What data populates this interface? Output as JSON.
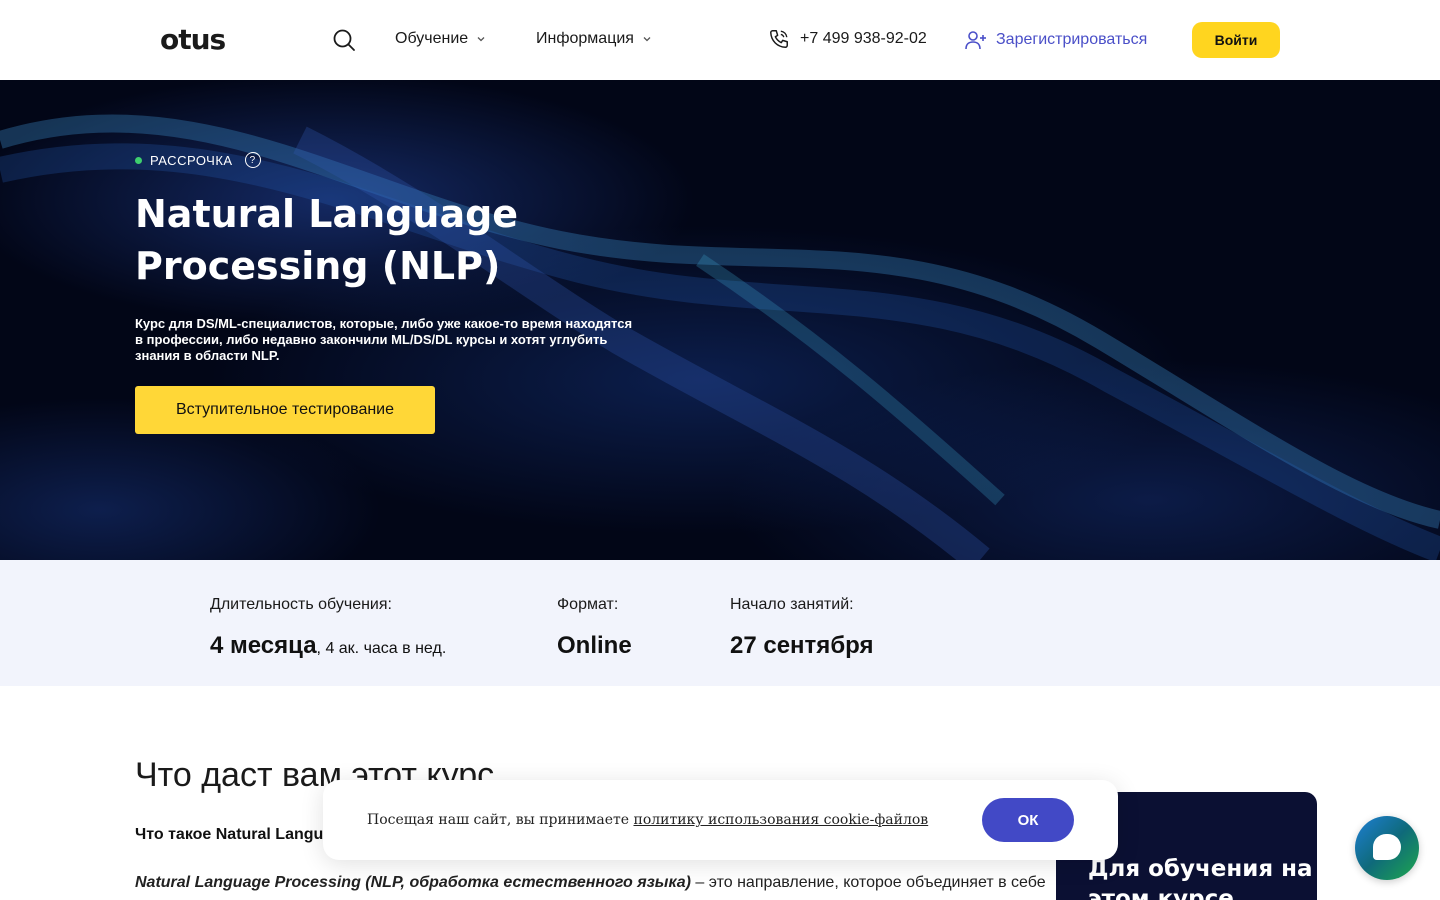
{
  "header": {
    "logo": "otus",
    "nav": [
      {
        "label": "Обучение"
      },
      {
        "label": "Информация"
      }
    ],
    "phone": "+7 499 938-92-02",
    "register_label": "Зарегистрироваться",
    "login_label": "Войти"
  },
  "hero": {
    "badge": "РАССРОЧКА",
    "badge_help": "?",
    "title": "Natural Language Processing (NLP)",
    "description": "Курс для DS/ML-специалистов, которые, либо уже какое-то время находятся в профессии, либо недавно закончили ML/DS/DL курсы и хотят углубить знания в области NLP.",
    "cta_label": "Вступительное тестирование"
  },
  "info": {
    "duration_label": "Длительность обучения:",
    "duration_value": "4 месяца",
    "duration_sub": ", 4 ак. часа в нед.",
    "format_label": "Формат:",
    "format_value": "Online",
    "start_label": "Начало занятий:",
    "start_value": "27 сентября"
  },
  "content": {
    "section_title": "Что даст вам этот курс",
    "question": "Что такое Natural Langua",
    "para_em": "Natural Language Processing (NLP, обработка естественного языка)",
    "para_rest": " – это направление, которое объединяет в себе"
  },
  "side_card": {
    "title": "Для обучения на этом курсе"
  },
  "cookie": {
    "text": "Посещая наш сайт, вы принимаете ",
    "link": "политику использования cookie-файлов",
    "ok_label": "ОК"
  },
  "colors": {
    "accent_yellow": "#ffd51f",
    "brand_blue": "#4249c6",
    "info_bg": "#f2f4fc"
  }
}
